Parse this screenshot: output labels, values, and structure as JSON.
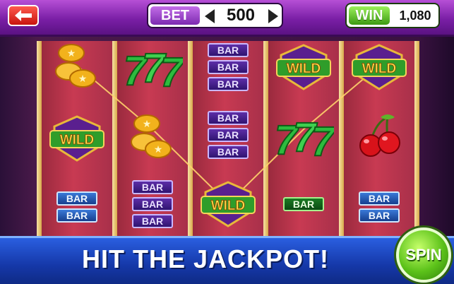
{
  "header": {
    "bet_label": "BET",
    "bet_value": "500",
    "win_label": "WIN",
    "win_value": "1,080"
  },
  "reels": [
    [
      "coins",
      "wild",
      "bar-double-blue"
    ],
    [
      "seven",
      "coins",
      "bar-triple-purple"
    ],
    [
      "bar-triple-purple",
      "bar-triple-purple",
      "wild"
    ],
    [
      "wild",
      "seven",
      "bar-single-green"
    ],
    [
      "wild",
      "cherry",
      "bar-double-blue"
    ]
  ],
  "symbols": {
    "bar_text": "BAR",
    "wild_text": "WILD"
  },
  "banner": {
    "text": "HIT THE JACKPOT!"
  },
  "spin_label": "SPIN",
  "colors": {
    "header": "#8a2bb8",
    "reel": "#c83a52",
    "banner": "#1d47c4",
    "spin": "#5cc21a",
    "win_line": "#ffd36b"
  },
  "icons": {
    "back": "back-arrow-icon",
    "bet_down": "left-arrow-icon",
    "bet_up": "right-arrow-icon"
  }
}
